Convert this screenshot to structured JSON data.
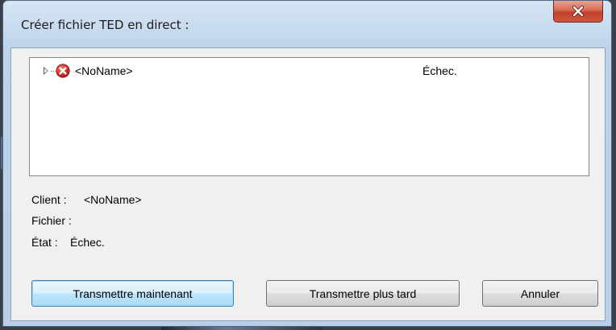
{
  "dialog": {
    "title": "Créer fichier TED en direct :",
    "close_icon": "close-x-icon"
  },
  "list": {
    "rows": [
      {
        "icon": "error-icon",
        "name": "<NoName>",
        "status": "Échec."
      }
    ]
  },
  "info": {
    "client_label": "Client :",
    "client_value": "<NoName>",
    "file_label": "Fichier :",
    "file_value": "",
    "state_label": "État :",
    "state_value": "Échec."
  },
  "buttons": {
    "send_now": "Transmettre maintenant",
    "send_later": "Transmettre plus tard",
    "cancel": "Annuler"
  },
  "colors": {
    "title_bar": "#c5d9ee",
    "close_button": "#c1402a",
    "error_icon": "#d9362b",
    "client_bg": "#f0f0f0"
  }
}
